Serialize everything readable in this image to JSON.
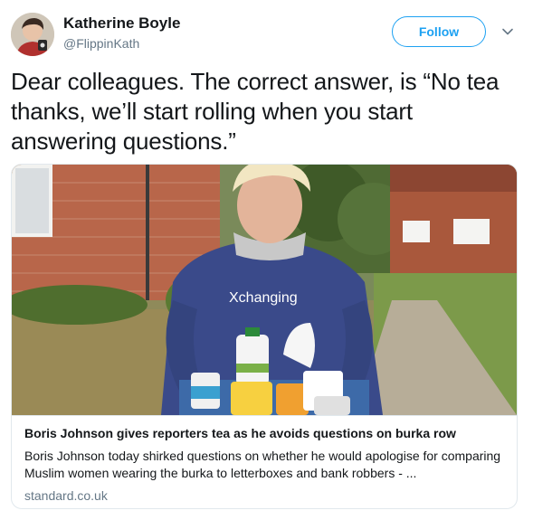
{
  "author": {
    "name": "Katherine Boyle",
    "handle": "@FlippinKath"
  },
  "follow_button": {
    "label": "Follow"
  },
  "menu": {
    "icon": "chevron-down-icon"
  },
  "tweet": {
    "text": "Dear colleagues. The correct answer, is “No tea thanks, we’ll start rolling when you start answering questions.”"
  },
  "card": {
    "image_overlay_text": "Xchanging",
    "title": "Boris Johnson gives reporters tea as he avoids questions on burka row",
    "description": "Boris Johnson today shirked questions on whether he would apologise for comparing Muslim women wearing the burka to letterboxes and bank robbers - ...",
    "domain": "standard.co.uk"
  },
  "colors": {
    "accent": "#1da1f2",
    "text": "#14171a",
    "secondary_text": "#657786",
    "border": "#e1e8ed"
  }
}
